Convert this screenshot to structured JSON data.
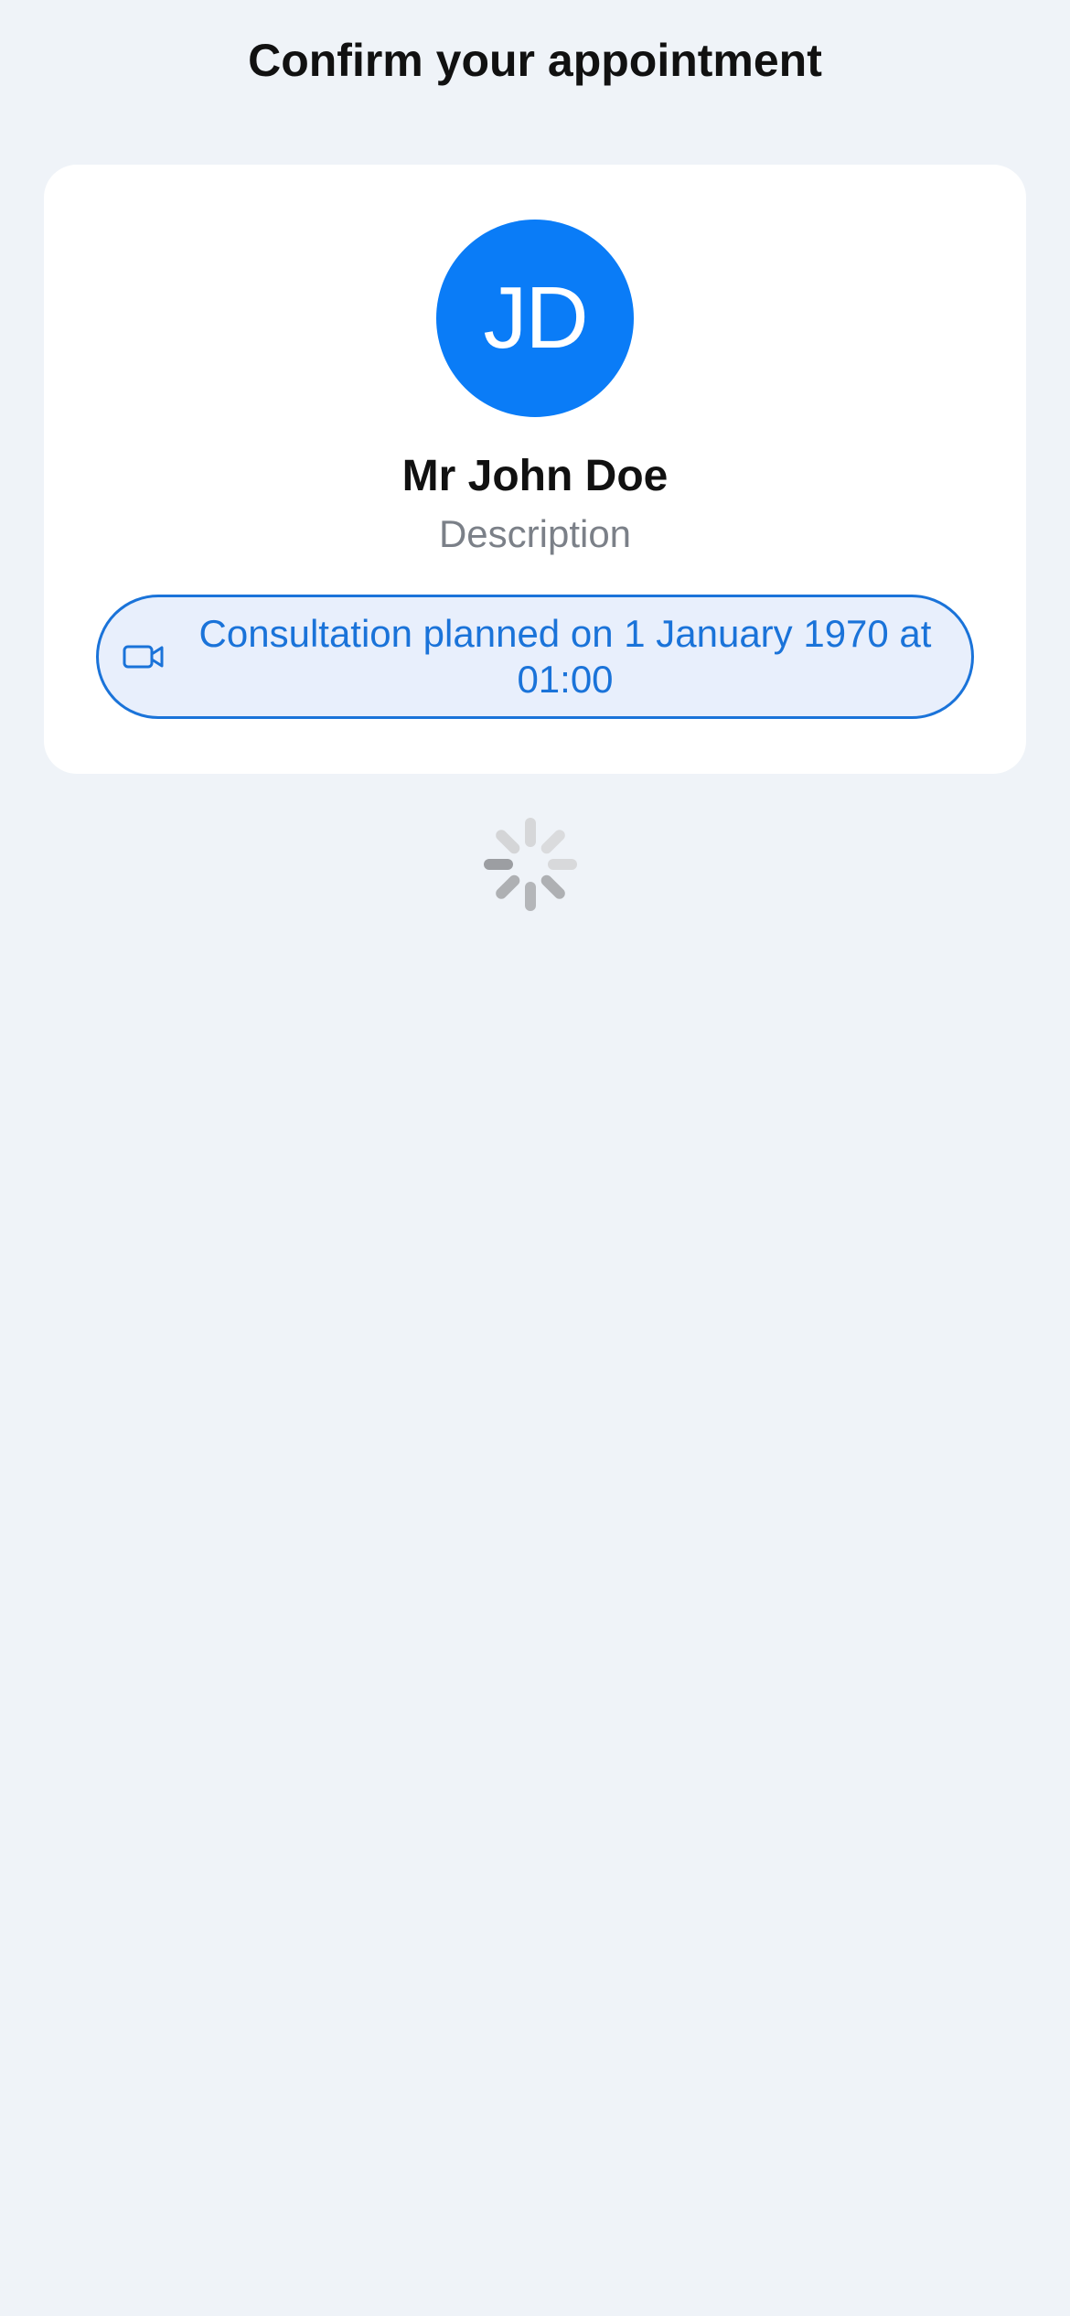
{
  "header": {
    "title": "Confirm your appointment"
  },
  "card": {
    "avatar_initials": "JD",
    "name": "Mr John Doe",
    "description": "Description",
    "consultation_text": "Consultation planned on 1 January 1970 at 01:00",
    "consultation_icon": "video-camera-icon"
  },
  "loading": {
    "spinner_icon": "loading-spinner-icon"
  },
  "colors": {
    "background": "#eff3f8",
    "accent": "#0a7cf7",
    "pill_border": "#1a73d9",
    "pill_background": "#e8effc",
    "muted_text": "#7b8088"
  }
}
